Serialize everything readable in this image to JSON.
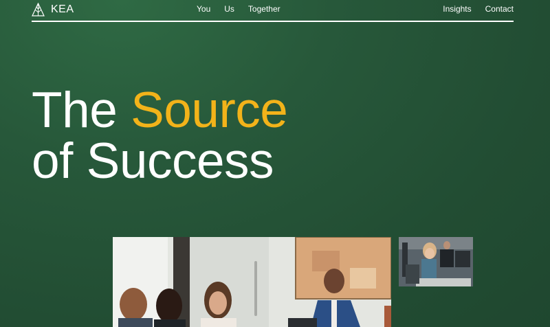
{
  "brand": {
    "name": "KEA",
    "logo_icon": "kea-tree-logo-icon"
  },
  "nav": {
    "center": [
      {
        "label": "You"
      },
      {
        "label": "Us"
      },
      {
        "label": "Together"
      }
    ],
    "right": [
      {
        "label": "Insights"
      },
      {
        "label": "Contact"
      }
    ]
  },
  "hero": {
    "line1_prefix": "The",
    "line1_accent": "Source",
    "line2": "of Success"
  },
  "colors": {
    "background": "#24503a",
    "accent": "#f2b31a",
    "text": "#ffffff"
  },
  "images": [
    {
      "name": "team-meeting-photo",
      "alt": ""
    },
    {
      "name": "office-workers-photo",
      "alt": ""
    }
  ]
}
